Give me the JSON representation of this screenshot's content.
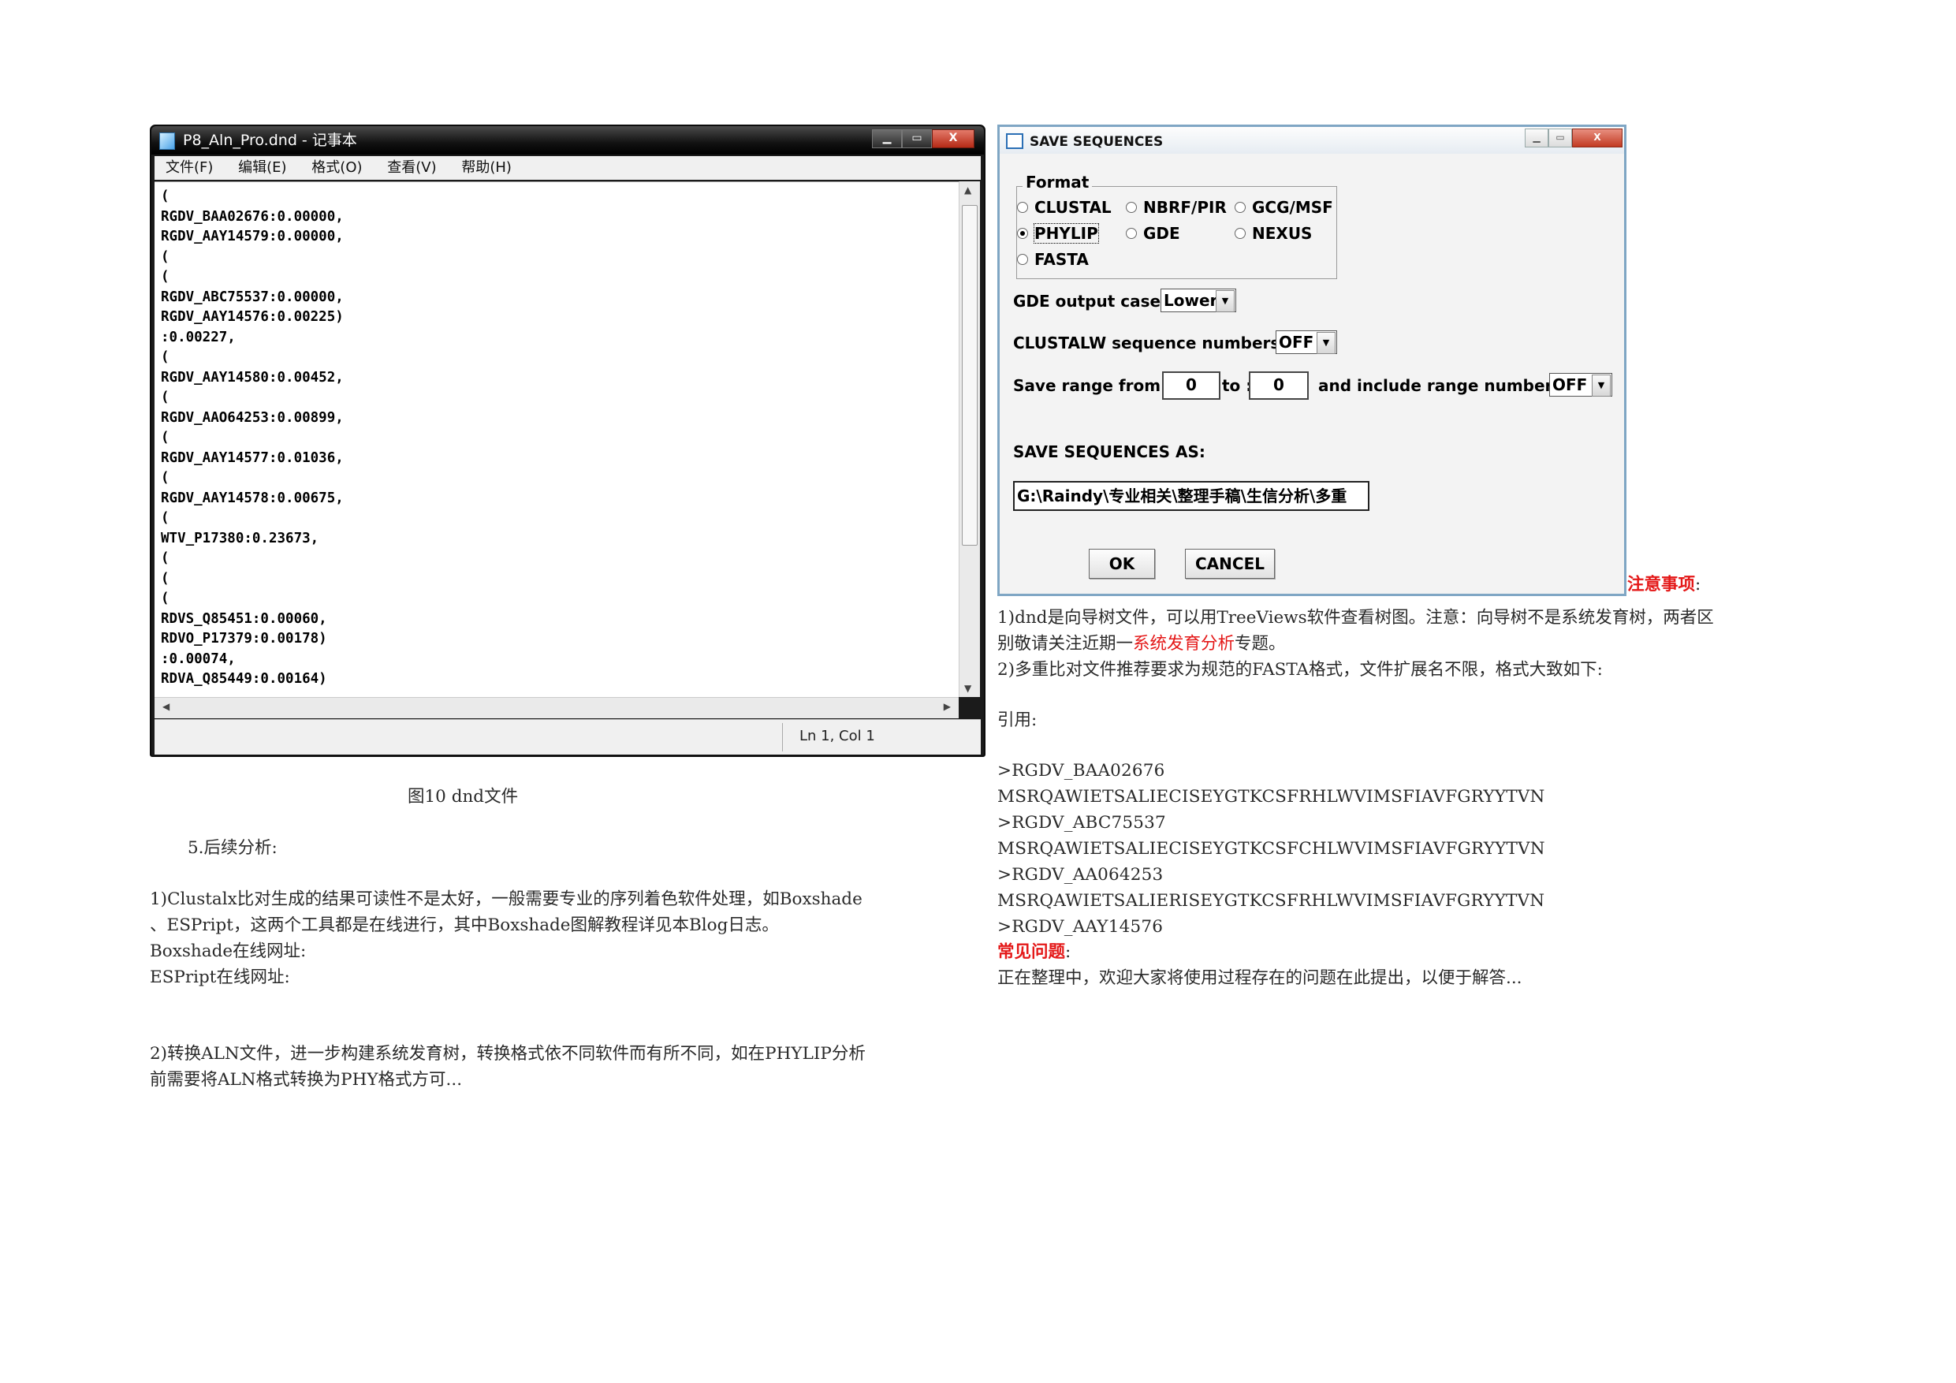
{
  "notepad": {
    "title": "P8_Aln_Pro.dnd - 记事本",
    "controls": {
      "minimize": "▁",
      "maximize": "▭",
      "close": "X"
    },
    "menu": [
      "文件(F)",
      "编辑(E)",
      "格式(O)",
      "查看(V)",
      "帮助(H)"
    ],
    "content": "(\nRGDV_BAA02676:0.00000,\nRGDV_AAY14579:0.00000,\n(\n(\nRGDV_ABC75537:0.00000,\nRGDV_AAY14576:0.00225)\n:0.00227,\n(\nRGDV_AAY14580:0.00452,\n(\nRGDV_AAO64253:0.00899,\n(\nRGDV_AAY14577:0.01036,\n(\nRGDV_AAY14578:0.00675,\n(\nWTV_P17380:0.23673,\n(\n(\n(\nRDVS_Q85451:0.00060,\nRDVO_P17379:0.00178)\n:0.00074,\nRDVA_Q85449:0.00164)",
    "status": "Ln 1, Col 1"
  },
  "figure_caption": "图10 dnd文件",
  "left_text": {
    "section_heading": "5.后续分析:",
    "para1_line1": "1)Clustalx比对生成的结果可读性不是太好，一般需要专业的序列着色软件处理，如Boxshade",
    "para1_line2": "、ESPript，这两个工具都是在线进行，其中Boxshade图解教程详见本Blog日志。",
    "boxshade_url_label": "Boxshade在线网址:",
    "espript_url_label": "ESPript在线网址:",
    "para2_line1": "2)转换ALN文件，进一步构建系统发育树，转换格式依不同软件而有所不同，如在PHYLIP分析",
    "para2_line2": "前需要将ALN格式转换为PHY格式方可..."
  },
  "save_dialog": {
    "title": "SAVE SEQUENCES",
    "controls": {
      "minimize": "▁",
      "maximize": "▭",
      "close": "X"
    },
    "format_legend": "Format",
    "formats": [
      {
        "label": "CLUSTAL",
        "checked": false
      },
      {
        "label": "NBRF/PIR",
        "checked": false
      },
      {
        "label": "GCG/MSF",
        "checked": false
      },
      {
        "label": "PHYLIP",
        "checked": true
      },
      {
        "label": "GDE",
        "checked": false
      },
      {
        "label": "NEXUS",
        "checked": false
      },
      {
        "label": "FASTA",
        "checked": false
      }
    ],
    "gde_label": "GDE output case :",
    "gde_value": "Lower",
    "clustalw_label": "CLUSTALW sequence numbers :",
    "clustalw_value": "OFF",
    "range_from_label": "Save range from  :",
    "range_from": "0",
    "range_to_label": "to :",
    "range_to": "0",
    "include_label": "and include range numbers :",
    "include_value": "OFF",
    "save_as_label": "SAVE SEQUENCES AS:",
    "path": "G:\\Raindy\\专业相关\\整理手稿\\生信分析\\多重",
    "ok": "OK",
    "cancel": "CANCEL"
  },
  "right_text": {
    "notes_heading": "注意事项",
    "notes_colon": ":",
    "note1_line1": "1)dnd是向导树文件，可以用TreeViews软件查看树图。注意：向导树不是系统发育树，两者区",
    "note1_line2_a": "别敬请关注近期一",
    "note1_line2_link": "系统发育分析",
    "note1_line2_b": "专题。",
    "note2": "2)多重比对文件推荐要求为规范的FASTA格式，文件扩展名不限，格式大致如下:",
    "quote_label": "引用:",
    "fasta": [
      ">RGDV_BAA02676",
      "MSRQAWIETSALIECISEYGTKCSFRHLWVIMSFIAVFGRYYTVN",
      ">RGDV_ABC75537",
      "MSRQAWIETSALIECISEYGTKCSFCHLWVIMSFIAVFGRYYTVN",
      ">RGDV_AA064253",
      "MSRQAWIETSALIERISEYGTKCSFRHLWVIMSFIAVFGRYYTVN",
      ">RGDV_AAY14576"
    ],
    "faq_heading": "常见问题",
    "faq_colon": ":",
    "faq_text": "正在整理中，欢迎大家将使用过程存在的问题在此提出，以便于解答..."
  }
}
